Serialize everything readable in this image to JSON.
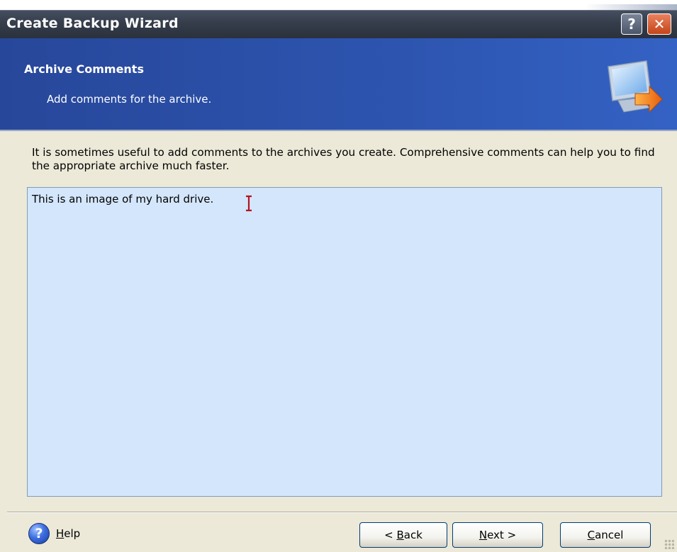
{
  "window": {
    "title": "Create Backup Wizard",
    "help_glyph": "?",
    "close_glyph": "✕"
  },
  "header": {
    "title": "Archive Comments",
    "subtitle": "Add comments for the archive.",
    "icon": "monitor-arrow-icon"
  },
  "body": {
    "description": "It is sometimes useful to add comments to the archives you create. Comprehensive comments can help you to find the appropriate archive much faster.",
    "comment_value": "This is an image of my hard drive."
  },
  "footer": {
    "help_glyph": "?",
    "help_label": {
      "accel": "H",
      "rest": "elp"
    },
    "back_label": {
      "pre": "< ",
      "accel": "B",
      "rest": "ack"
    },
    "next_label": {
      "accel": "N",
      "rest": "ext >"
    },
    "cancel_label": {
      "accel": "C",
      "rest": "ancel"
    }
  },
  "colors": {
    "titlebar": "#353d4b",
    "header": "#2d55b0",
    "textarea": "#d4e6fb",
    "dialog": "#ece9d8",
    "close_button": "#c44419",
    "caret": "#b3141e"
  }
}
